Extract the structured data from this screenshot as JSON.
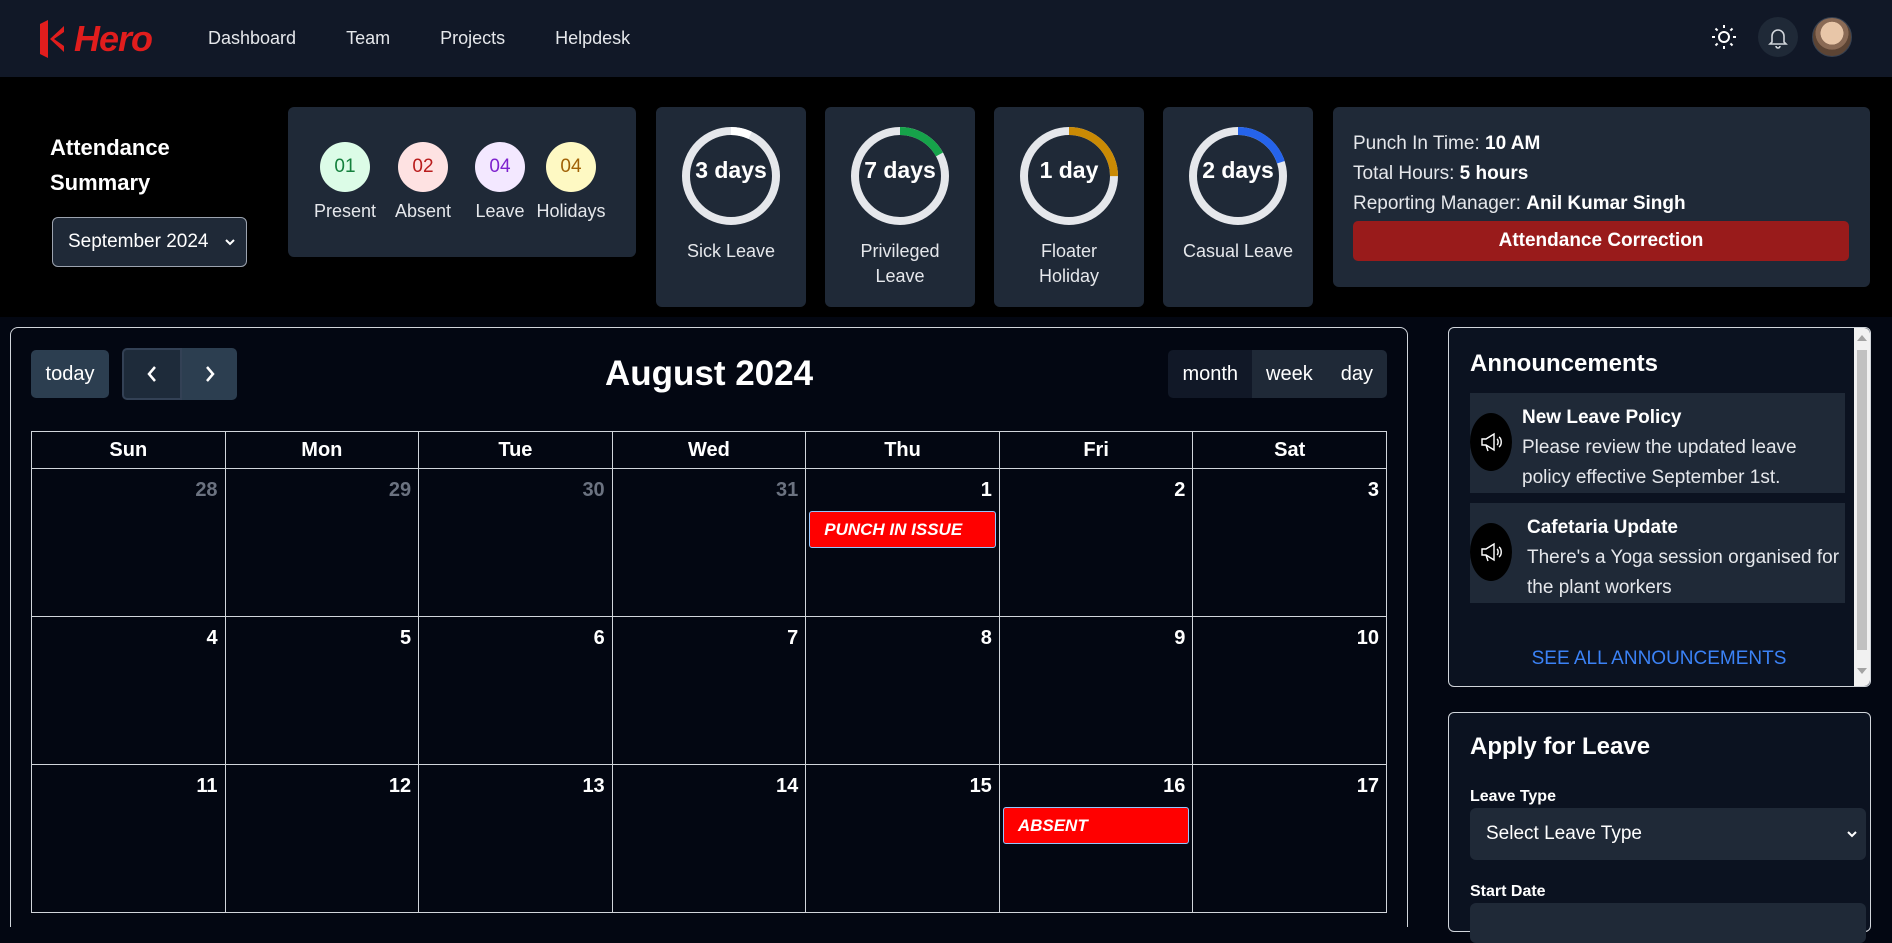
{
  "brand": {
    "name": "Hero",
    "color": "#e11d1d"
  },
  "nav": {
    "links": [
      "Dashboard",
      "Team",
      "Projects",
      "Helpdesk"
    ]
  },
  "icons": {
    "theme": "sun-icon",
    "notifications": "bell-icon",
    "profile": "avatar"
  },
  "summary": {
    "title": "Attendance Summary",
    "month": "September 2024",
    "counts": [
      {
        "value": "01",
        "label": "Present",
        "bg": "#dcfce7",
        "fg": "#15803d"
      },
      {
        "value": "02",
        "label": "Absent",
        "bg": "#fee2e2",
        "fg": "#b91c1c"
      },
      {
        "value": "04",
        "label": "Leave",
        "bg": "#f3e8ff",
        "fg": "#7e22ce"
      },
      {
        "value": "04",
        "label": "Holidays",
        "bg": "#fef9c3",
        "fg": "#a16207"
      }
    ],
    "leaves": [
      {
        "value": "3 days",
        "label": "Sick Leave",
        "color": "#ffffff",
        "fraction": 0.07
      },
      {
        "value": "7 days",
        "label": "Privileged Leave",
        "color": "#16a34a",
        "fraction": 0.17
      },
      {
        "value": "1 day",
        "label": "Floater Holiday",
        "color": "#ca8a04",
        "fraction": 0.25
      },
      {
        "value": "2 days",
        "label": "Casual Leave",
        "color": "#2563eb",
        "fraction": 0.2
      }
    ],
    "info": {
      "punch_in_label": "Punch In Time: ",
      "punch_in_value": "10 AM",
      "total_hours_label": "Total Hours: ",
      "total_hours_value": "5 hours",
      "manager_label": "Reporting Manager: ",
      "manager_value": "Anil Kumar Singh",
      "correction_button": "Attendance Correction"
    }
  },
  "calendar": {
    "today_button": "today",
    "title": "August 2024",
    "views": [
      "month",
      "week",
      "day"
    ],
    "weekdays": [
      "Sun",
      "Mon",
      "Tue",
      "Wed",
      "Thu",
      "Fri",
      "Sat"
    ],
    "weeks": [
      [
        {
          "day": "28",
          "muted": true
        },
        {
          "day": "29",
          "muted": true
        },
        {
          "day": "30",
          "muted": true
        },
        {
          "day": "31",
          "muted": true
        },
        {
          "day": "1",
          "event": "PUNCH IN ISSUE"
        },
        {
          "day": "2"
        },
        {
          "day": "3"
        }
      ],
      [
        {
          "day": "4"
        },
        {
          "day": "5"
        },
        {
          "day": "6"
        },
        {
          "day": "7"
        },
        {
          "day": "8"
        },
        {
          "day": "9"
        },
        {
          "day": "10"
        }
      ],
      [
        {
          "day": "11"
        },
        {
          "day": "12"
        },
        {
          "day": "13"
        },
        {
          "day": "14"
        },
        {
          "day": "15"
        },
        {
          "day": "16",
          "event": "ABSENT"
        },
        {
          "day": "17"
        }
      ]
    ]
  },
  "announcements": {
    "title": "Announcements",
    "items": [
      {
        "title": "New Leave Policy",
        "body": "Please review the updated leave policy effective September 1st."
      },
      {
        "title": "Cafetaria Update",
        "body": "There's a Yoga session organised for the plant workers"
      }
    ],
    "see_all": "SEE ALL ANNOUNCEMENTS"
  },
  "leave_form": {
    "title": "Apply for Leave",
    "leave_type_label": "Leave Type",
    "leave_type_value": "Select Leave Type",
    "start_date_label": "Start Date"
  }
}
